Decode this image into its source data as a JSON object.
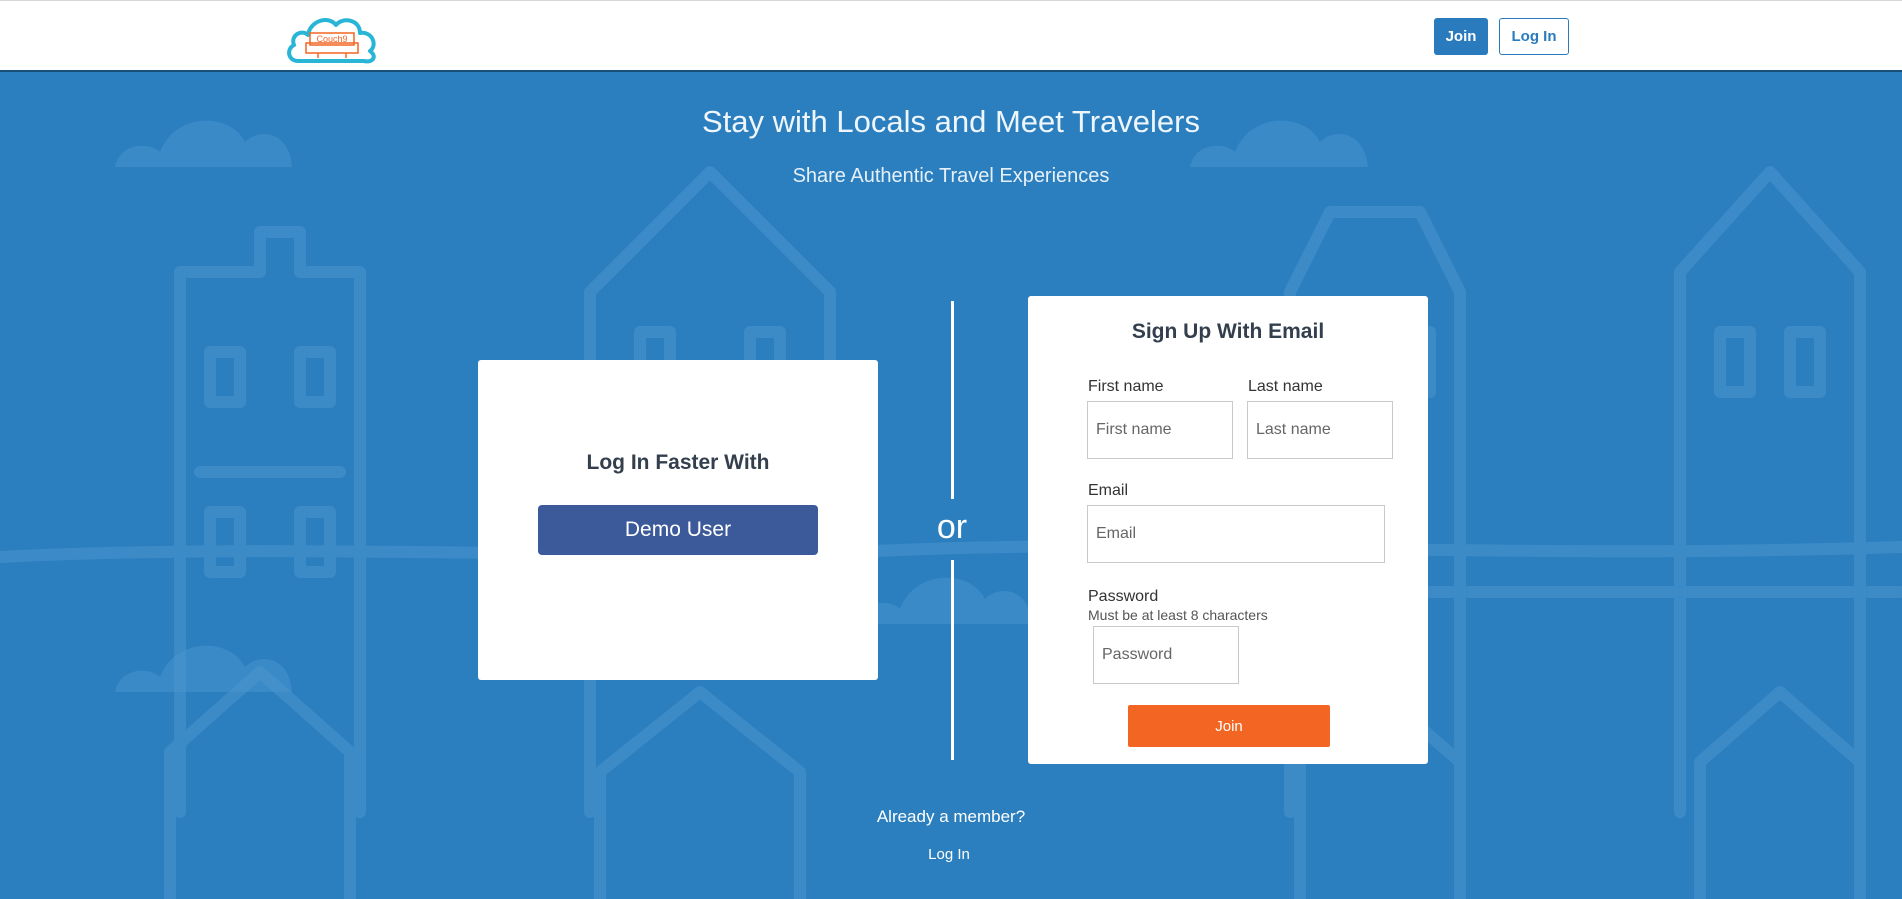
{
  "header": {
    "logo_text": "Couch9",
    "join_label": "Join",
    "login_label": "Log In"
  },
  "hero": {
    "title": "Stay with Locals and Meet Travelers",
    "subtitle": "Share Authentic Travel Experiences"
  },
  "login_card": {
    "heading": "Log In Faster With",
    "demo_button": "Demo User"
  },
  "divider": {
    "or_text": "or"
  },
  "signup_card": {
    "heading": "Sign Up With Email",
    "first_name_label": "First name",
    "first_name_placeholder": "First name",
    "first_name_value": "",
    "last_name_label": "Last name",
    "last_name_placeholder": "Last name",
    "last_name_value": "",
    "email_label": "Email",
    "email_placeholder": "Email",
    "email_value": "",
    "password_label": "Password",
    "password_hint": "Must be at least 8 characters",
    "password_placeholder": "Password",
    "password_value": "",
    "join_button": "Join"
  },
  "footer": {
    "already_member": "Already a member?",
    "login_link": "Log In"
  },
  "colors": {
    "background": "#2b7fbf",
    "primary": "#2a7bbd",
    "demo_button": "#3c5a9a",
    "join_button": "#f26522",
    "logo_cloud": "#29b6d6",
    "logo_couch": "#f26522"
  }
}
